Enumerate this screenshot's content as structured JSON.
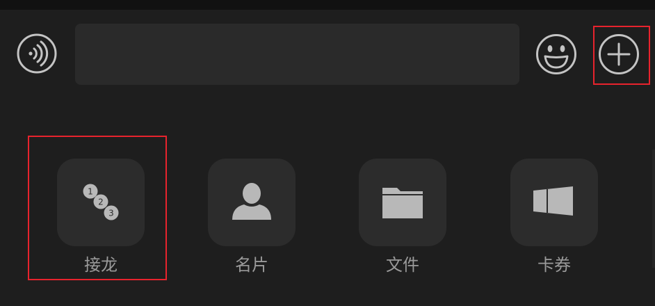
{
  "input_bar": {
    "voice_icon": "voice-wave-icon",
    "text_value": "",
    "emoji_icon": "smiley-face-icon",
    "plus_icon": "plus-circle-icon"
  },
  "panel": {
    "items": [
      {
        "label": "接龙",
        "icon": "numbered-chain-icon",
        "numbers": [
          "1",
          "2",
          "3"
        ]
      },
      {
        "label": "名片",
        "icon": "person-card-icon"
      },
      {
        "label": "文件",
        "icon": "folder-icon"
      },
      {
        "label": "卡券",
        "icon": "ticket-icon"
      }
    ]
  },
  "colors": {
    "background": "#1e1e1e",
    "tile": "#2c2c2c",
    "icon": "#b8b8b8",
    "label": "#9a9a9a",
    "highlight": "#e8232d"
  }
}
